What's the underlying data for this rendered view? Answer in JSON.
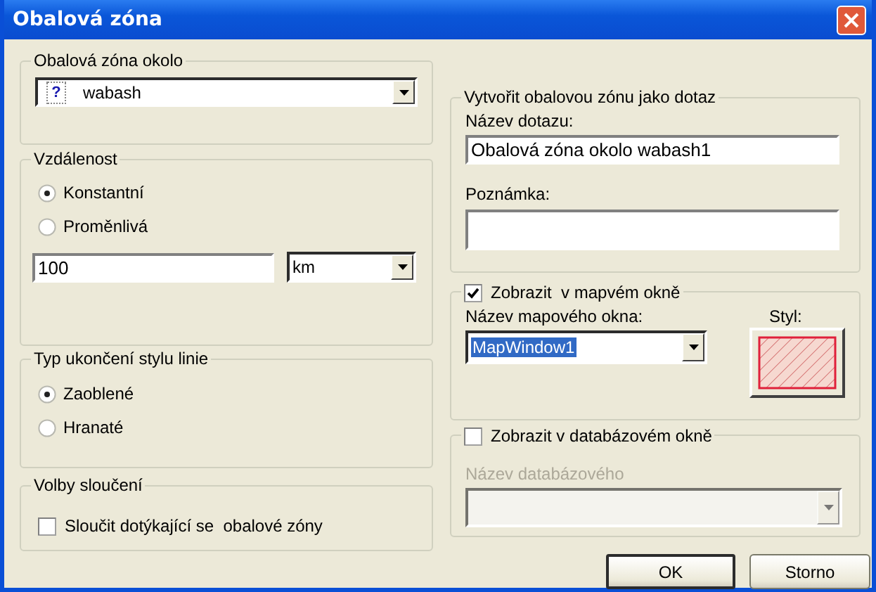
{
  "window": {
    "title": "Obalová zóna"
  },
  "around": {
    "label": "Obalová zóna okolo",
    "icon_text": "?",
    "value": "wabash"
  },
  "distance": {
    "label": "Vzdálenost",
    "options": [
      {
        "label": "Konstantní",
        "selected": true
      },
      {
        "label": "Proměnlivá",
        "selected": false
      }
    ],
    "value": "100",
    "unit": "km"
  },
  "line_end": {
    "label": "Typ ukončení stylu linie",
    "options": [
      {
        "label": "Zaoblené",
        "selected": true
      },
      {
        "label": "Hranaté",
        "selected": false
      }
    ]
  },
  "merge": {
    "label": "Volby sloučení",
    "checkbox_label": "Sloučit dotýkající se  obalové zóny",
    "checked": false
  },
  "query": {
    "label": "Vytvořit obalovou zónu jako dotaz",
    "name_label": "Název dotazu:",
    "name_value": "Obalová zóna okolo wabash1",
    "note_label": "Poznámka:"
  },
  "map_window": {
    "label": "Zobrazit  v mapvém okně",
    "checked": true,
    "name_label": "Název mapového okna:",
    "value": "MapWindow1",
    "style_label": "Styl:"
  },
  "db_window": {
    "label": "Zobrazit v databázovém okně",
    "checked": false,
    "disabled": true,
    "name_label": "Název databázového"
  },
  "buttons": [
    {
      "label": "OK",
      "default": true
    },
    {
      "label": "Storno",
      "default": false
    }
  ]
}
